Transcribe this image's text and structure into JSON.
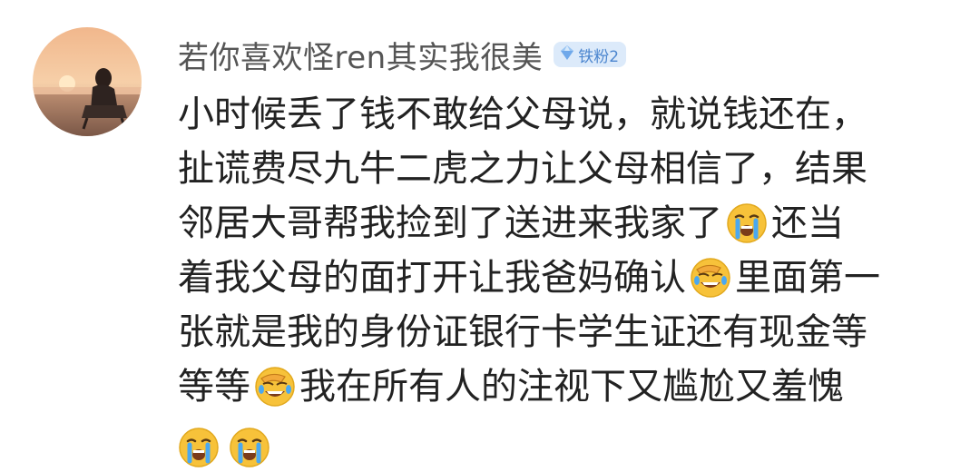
{
  "user": {
    "name": "若你喜欢怪ren其实我很美",
    "badge_label": "铁粉2",
    "badge_icon": "diamond-icon",
    "avatar": "avatar-photo-sunset"
  },
  "comment": {
    "lines": [
      [
        "小时候丢了钱不敢给父母说，就说钱还在，"
      ],
      [
        "扯谎费尽九牛二虎之力让父母相信了，结果"
      ],
      [
        "邻居大哥帮我捡到了送进来我家了",
        "还当"
      ],
      [
        "着我父母的面打开让我爸妈确认",
        "里面第一"
      ],
      [
        "张就是我的身份证银行卡学生证还有现金等"
      ],
      [
        "等等",
        "我在所有人的注视下又尴尬又羞愧"
      ]
    ],
    "emojis": {
      "line3": "crying-emoji",
      "line4": "facepalm-laugh-emoji",
      "line6": "facepalm-laugh-emoji",
      "trailing": [
        "crying-emoji",
        "crying-emoji"
      ]
    }
  },
  "colors": {
    "username": "#555555",
    "text": "#222222",
    "badge_bg": "#dceafa",
    "badge_text": "#4c86cf",
    "emoji_yellow": "#f7c23a",
    "tear_blue": "#4aa8f0"
  }
}
